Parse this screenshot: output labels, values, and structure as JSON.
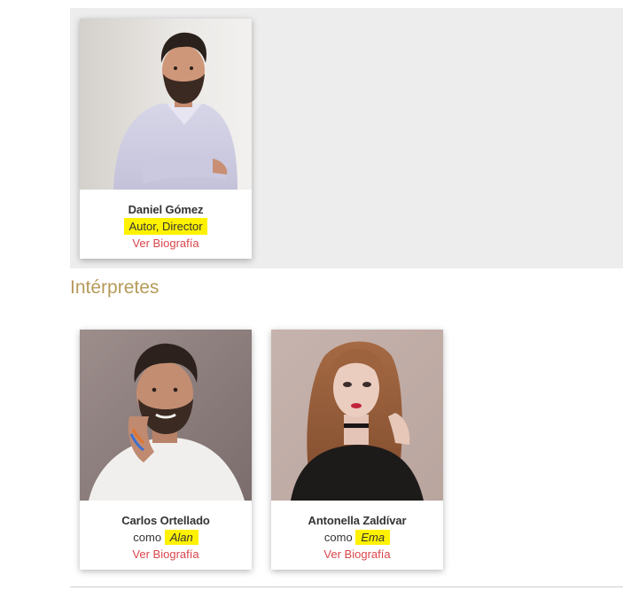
{
  "creators": [
    {
      "name": "Daniel Gómez",
      "role": "Autor, Director",
      "bio_link": "Ver Biografía"
    }
  ],
  "performers_section": {
    "title": "Intérpretes"
  },
  "performers": [
    {
      "name": "Carlos Ortellado",
      "como": "como",
      "character": "Alan",
      "bio_link": "Ver Biografía"
    },
    {
      "name": "Antonella Zaldívar",
      "como": "como",
      "character": "Ema",
      "bio_link": "Ver Biografía"
    }
  ],
  "colors": {
    "highlight": "#fff200",
    "link": "#d9464b",
    "section_title": "#b59b5a",
    "panel_bg": "#ededed"
  }
}
